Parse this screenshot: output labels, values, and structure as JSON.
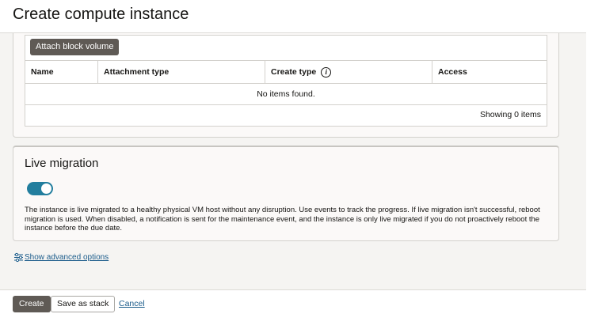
{
  "header": {
    "title": "Create compute instance"
  },
  "block_volumes": {
    "attach_button": "Attach block volume",
    "columns": [
      "Name",
      "Attachment type",
      "Create type",
      "Access"
    ],
    "empty_message": "No items found.",
    "footer": "Showing 0 items"
  },
  "live_migration": {
    "title": "Live migration",
    "enabled": true,
    "description": "The instance is live migrated to a healthy physical VM host without any disruption. Use events to track the progress. If live migration isn't successful, reboot migration is used. When disabled, a notification is sent for the maintenance event, and the instance is only live migrated if you do not proactively reboot the instance before the due date."
  },
  "advanced": {
    "label": "Show advanced options"
  },
  "actions": {
    "create": "Create",
    "save_stack": "Save as stack",
    "cancel": "Cancel"
  },
  "colors": {
    "primary_button": "#5f5a55",
    "toggle_on": "#227e9e",
    "link": "#1a5b8a"
  }
}
